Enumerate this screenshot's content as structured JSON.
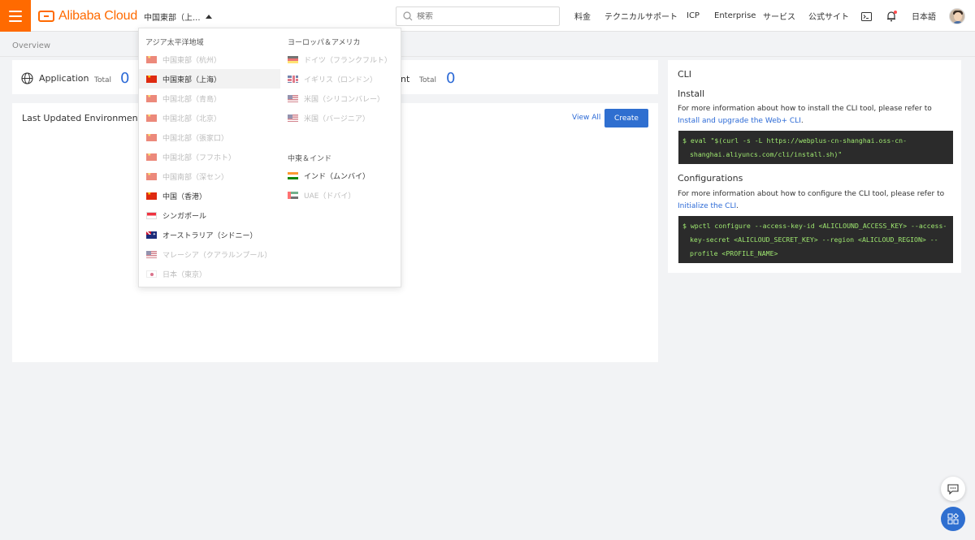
{
  "header": {
    "brand": "Alibaba Cloud",
    "region_selected": "中国東部（上...",
    "search_placeholder": "検索",
    "nav": [
      "料金",
      "テクニカルサポート",
      "ICP",
      "Enterprise",
      "サービス",
      "公式サイト"
    ],
    "language": "日本語"
  },
  "breadcrumb": "Overview",
  "stats": {
    "application_label": "Application",
    "total_label": "Total",
    "application_total": "0",
    "environment_label_tail": "nt",
    "environment_total_label": "Total",
    "environment_total": "0"
  },
  "environments": {
    "title": "Last Updated Environments",
    "view_all": "View All",
    "create": "Create"
  },
  "region_dropdown": {
    "group_asia": "アジア太平洋地域",
    "group_europe_americas": "ヨーロッパ＆アメリカ",
    "group_middle_east_india": "中東＆インド",
    "asia": [
      {
        "label": "中国東部（杭州）",
        "flag": "cn",
        "state": "disabled"
      },
      {
        "label": "中国東部（上海）",
        "flag": "cn",
        "state": "selected"
      },
      {
        "label": "中国北部（青島）",
        "flag": "cn",
        "state": "disabled"
      },
      {
        "label": "中国北部（北京）",
        "flag": "cn",
        "state": "disabled"
      },
      {
        "label": "中国北部（張家口）",
        "flag": "cn",
        "state": "disabled"
      },
      {
        "label": "中国北部（フフホト）",
        "flag": "cn",
        "state": "disabled"
      },
      {
        "label": "中国南部（深セン）",
        "flag": "cn",
        "state": "disabled"
      },
      {
        "label": "中国（香港）",
        "flag": "cn",
        "state": "enabled"
      },
      {
        "label": "シンガポール",
        "flag": "sg",
        "state": "enabled"
      },
      {
        "label": "オーストラリア（シドニー）",
        "flag": "au",
        "state": "enabled"
      },
      {
        "label": "マレーシア（クアラルンプール）",
        "flag": "us",
        "state": "disabled"
      },
      {
        "label": "日本（東京）",
        "flag": "jp",
        "state": "disabled"
      }
    ],
    "europe_americas": [
      {
        "label": "ドイツ（フランクフルト）",
        "flag": "de",
        "state": "disabled"
      },
      {
        "label": "イギリス（ロンドン）",
        "flag": "gb",
        "state": "disabled"
      },
      {
        "label": "米国（シリコンバレー）",
        "flag": "us",
        "state": "disabled"
      },
      {
        "label": "米国（バージニア）",
        "flag": "us",
        "state": "disabled"
      }
    ],
    "middle_east_india": [
      {
        "label": "インド（ムンバイ）",
        "flag": "in",
        "state": "enabled"
      },
      {
        "label": "UAE（ドバイ）",
        "flag": "ae",
        "state": "disabled"
      }
    ]
  },
  "cli": {
    "title": "CLI",
    "install_heading": "Install",
    "install_text": "For more information about how to install the CLI tool, please refer to ",
    "install_link": "Install and upgrade the Web+ CLI",
    "install_command": "$ eval \"$(curl -s -L https://webplus-cn-shanghai.oss-cn-shanghai.aliyuncs.com/cli/install.sh)\"",
    "config_heading": "Configurations",
    "config_text": "For more information about how to configure the CLI tool, please refer to ",
    "config_link": "Initialize the CLI",
    "config_command": "$ wpctl configure --access-key-id <ALICLOUND_ACCESS_KEY> --access-key-secret <ALICLOUD_SECRET_KEY> --region <ALICLOUD_REGION> --profile <PROFILE_NAME>"
  },
  "colors": {
    "brand_orange": "#ff6a00",
    "primary_blue": "#2f6fd0",
    "code_bg": "#2b2b2b",
    "code_text": "#9fe870"
  }
}
